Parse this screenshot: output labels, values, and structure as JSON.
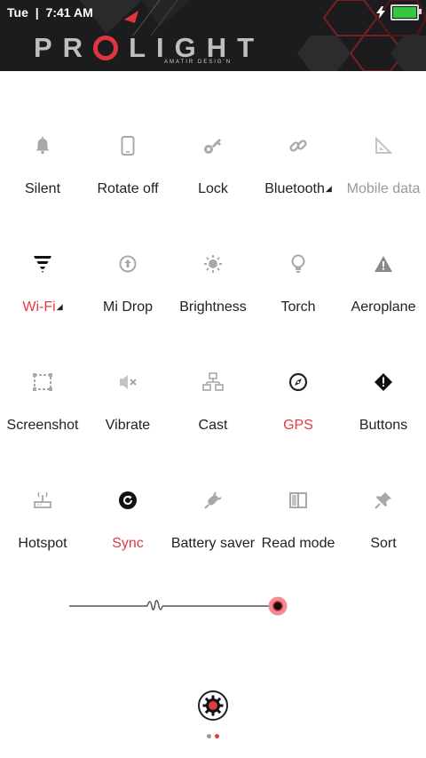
{
  "status_bar": {
    "day": "Tue",
    "time": "7:41 AM",
    "battery_level": 1.0,
    "charging": true,
    "battery_color": "#35c83f"
  },
  "header": {
    "logo_left": "PR",
    "logo_right": "LIGHT",
    "logo_subtitle": "AMATIR DESIG'N",
    "accent": "#e0343f"
  },
  "toggles": [
    {
      "label": "Silent",
      "icon": "bell-icon",
      "state": "off"
    },
    {
      "label": "Rotate off",
      "icon": "phone-icon",
      "state": "off"
    },
    {
      "label": "Lock",
      "icon": "key-icon",
      "state": "off"
    },
    {
      "label": "Bluetooth",
      "icon": "link-icon",
      "state": "off",
      "has_menu": true
    },
    {
      "label": "Mobile data",
      "icon": "signal-icon",
      "state": "disabled"
    },
    {
      "label": "Wi-Fi",
      "icon": "wifi-icon",
      "state": "on",
      "has_menu": true
    },
    {
      "label": "Mi Drop",
      "icon": "upload-icon",
      "state": "off"
    },
    {
      "label": "Brightness",
      "icon": "sun-icon",
      "state": "off"
    },
    {
      "label": "Torch",
      "icon": "bulb-icon",
      "state": "off"
    },
    {
      "label": "Aeroplane",
      "icon": "warning-icon",
      "state": "off"
    },
    {
      "label": "Screenshot",
      "icon": "screenshot-icon",
      "state": "off"
    },
    {
      "label": "Vibrate",
      "icon": "vibrate-icon",
      "state": "off"
    },
    {
      "label": "Cast",
      "icon": "cast-icon",
      "state": "off"
    },
    {
      "label": "GPS",
      "icon": "compass-icon",
      "state": "on"
    },
    {
      "label": "Buttons",
      "icon": "diamond-alert-icon",
      "state": "off"
    },
    {
      "label": "Hotspot",
      "icon": "hotspot-icon",
      "state": "off"
    },
    {
      "label": "Sync",
      "icon": "sync-icon",
      "state": "on"
    },
    {
      "label": "Battery saver",
      "icon": "plug-icon",
      "state": "off"
    },
    {
      "label": "Read mode",
      "icon": "book-icon",
      "state": "off"
    },
    {
      "label": "Sort",
      "icon": "pin-icon",
      "state": "off"
    }
  ],
  "brightness": {
    "level": 0.93,
    "accent": "#e53845"
  },
  "pager": {
    "pages": 2,
    "current": 1
  },
  "colors": {
    "active": "#e53845",
    "icon_gray": "#a8a8a8",
    "text": "#222222"
  }
}
